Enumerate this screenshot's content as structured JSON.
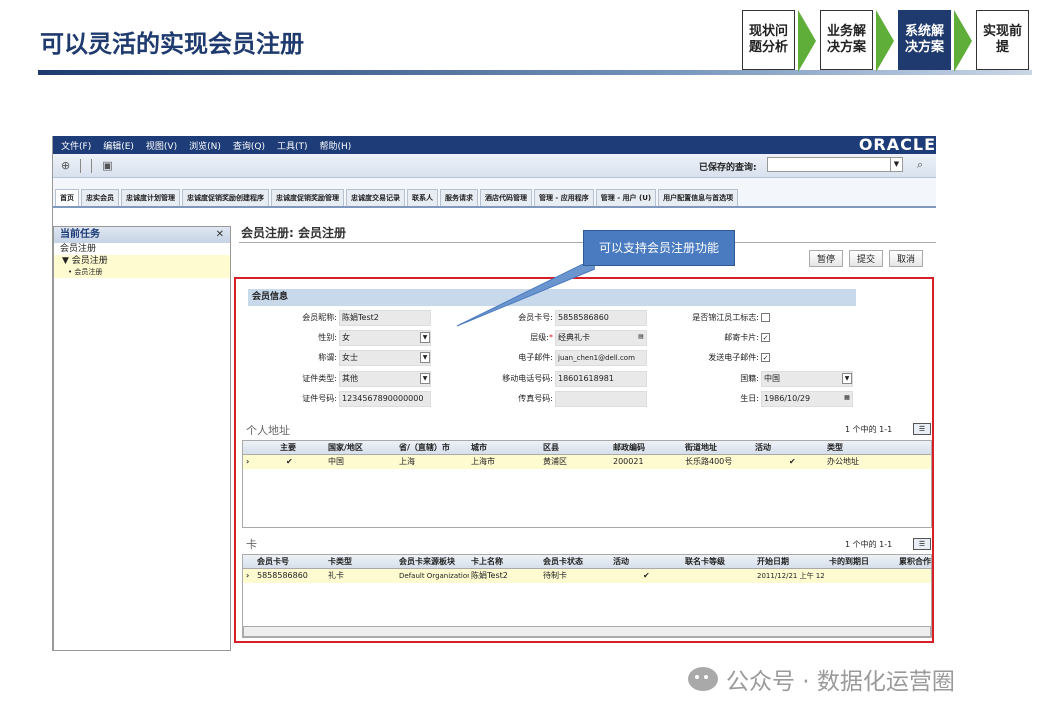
{
  "slide": {
    "title": "可以灵活的实现会员注册",
    "steps": [
      "现状问题分析",
      "业务解决方案",
      "系统解决方案",
      "实现前提"
    ],
    "active_step": 2
  },
  "app": {
    "menu": [
      "文件(F)",
      "编辑(E)",
      "视图(V)",
      "浏览(N)",
      "查询(Q)",
      "工具(T)",
      "帮助(H)"
    ],
    "logo": "ORACLE",
    "saved_query_label": "已保存的查询:",
    "tabs": [
      "首页",
      "忠实会员",
      "忠诚度计划管理",
      "忠诚度促销奖励创建程序",
      "忠诚度促销奖励管理",
      "忠诚度交易记录",
      "联系人",
      "服务请求",
      "酒店代码管理",
      "管理 - 应用程序",
      "管理 - 用户 (U)",
      "用户配置信息与首选项"
    ],
    "task_panel": {
      "title": "当前任务",
      "item": "会员注册",
      "sub_item": "▼ 会员注册",
      "sub_sub_item": "• 会员注册"
    },
    "breadcrumb": "会员注册: 会员注册",
    "buttons": {
      "pause": "暂停",
      "submit": "提交",
      "cancel": "取消"
    },
    "member_info": {
      "title": "会员信息",
      "nickname_label": "会员昵称:",
      "nickname": "陈娟Test2",
      "gender_label": "性别:",
      "gender": "女",
      "salutation_label": "称谓:",
      "salutation": "女士",
      "id_type_label": "证件类型:",
      "id_type": "其他",
      "id_no_label": "证件号码:",
      "id_no": "1234567890000000",
      "card_no_label": "会员卡号:",
      "card_no": "5858586860",
      "tier_label": "层级:",
      "tier_required": "*",
      "tier": "经典礼卡",
      "email_label": "电子邮件:",
      "email": "juan_chen1@dell.com",
      "mobile_label": "移动电话号码:",
      "mobile": "18601618981",
      "fax_label": "传真号码:",
      "fax": "",
      "employee_label": "是否锦江员工标志:",
      "employee_checked": false,
      "mail_card_label": "邮寄卡片:",
      "mail_card_checked": true,
      "send_email_label": "发送电子邮件:",
      "send_email_checked": true,
      "nationality_label": "国籍:",
      "nationality": "中国",
      "birthday_label": "生日:",
      "birthday": "1986/10/29"
    },
    "address": {
      "title": "个人地址",
      "pager": "1 个中的 1-1",
      "columns": [
        "主要",
        "国家/地区",
        "省/（直辖）市",
        "城市",
        "区县",
        "邮政编码",
        "街道地址",
        "活动",
        "类型"
      ],
      "rows": [
        {
          "primary": "✔",
          "country": "中国",
          "province": "上海",
          "city": "上海市",
          "district": "黄浦区",
          "postcode": "200021",
          "street": "长乐路400号",
          "active": "✔",
          "type": "办公地址"
        }
      ]
    },
    "cards": {
      "title": "卡",
      "pager": "1 个中的 1-1",
      "columns": [
        "会员卡号",
        "卡类型",
        "会员卡来源板块",
        "卡上名称",
        "会员卡状态",
        "活动",
        "联名卡等级",
        "开始日期",
        "卡的到期日",
        "累积合作"
      ],
      "rows": [
        {
          "card_no": "5858586860",
          "type": "礼卡",
          "source": "Default Organization",
          "name": "陈娟Test2",
          "status": "待制卡",
          "active": "✔",
          "co_brand": "",
          "start": "2011/12/21 上午 12",
          "expiry": "",
          "accum": ""
        }
      ]
    },
    "callout": "可以支持会员注册功能"
  },
  "watermark": "公众号 · 数据化运营圈"
}
